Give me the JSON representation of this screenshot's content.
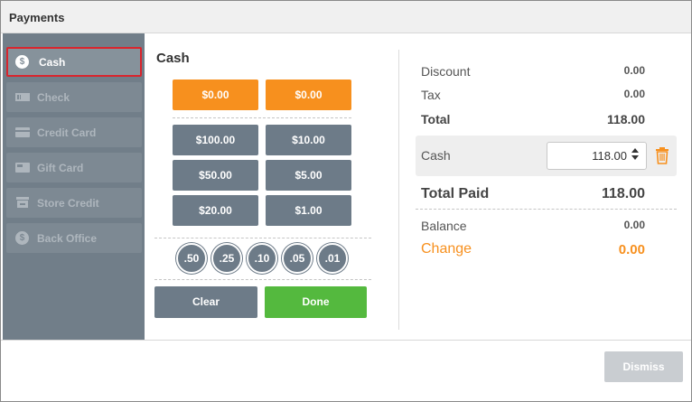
{
  "dialog": {
    "title": "Payments"
  },
  "sidebar": {
    "items": [
      {
        "label": "Cash",
        "icon": "dollar-coin-icon"
      },
      {
        "label": "Check",
        "icon": "check-icon"
      },
      {
        "label": "Credit Card",
        "icon": "credit-card-icon"
      },
      {
        "label": "Gift Card",
        "icon": "gift-card-icon"
      },
      {
        "label": "Store Credit",
        "icon": "store-icon"
      },
      {
        "label": "Back Office",
        "icon": "dollar-coin-icon"
      }
    ]
  },
  "keypad": {
    "title": "Cash",
    "quick": [
      "$0.00",
      "$0.00"
    ],
    "bills": [
      "$100.00",
      "$10.00",
      "$50.00",
      "$5.00",
      "$20.00",
      "$1.00"
    ],
    "coins": [
      ".50",
      ".25",
      ".10",
      ".05",
      ".01"
    ],
    "clear_label": "Clear",
    "done_label": "Done"
  },
  "summary": {
    "discount_label": "Discount",
    "discount_value": "0.00",
    "tax_label": "Tax",
    "tax_value": "0.00",
    "total_label": "Total",
    "total_value": "118.00",
    "cash_label": "Cash",
    "cash_value": "118.00",
    "total_paid_label": "Total Paid",
    "total_paid_value": "118.00",
    "balance_label": "Balance",
    "balance_value": "0.00",
    "change_label": "Change",
    "change_value": "0.00"
  },
  "footer": {
    "dismiss_label": "Dismiss"
  },
  "colors": {
    "accent": "#f7901e",
    "done": "#54b93e",
    "button_gray": "#6d7b88",
    "sidebar": "#717e89",
    "active_outline": "#d9252d"
  }
}
